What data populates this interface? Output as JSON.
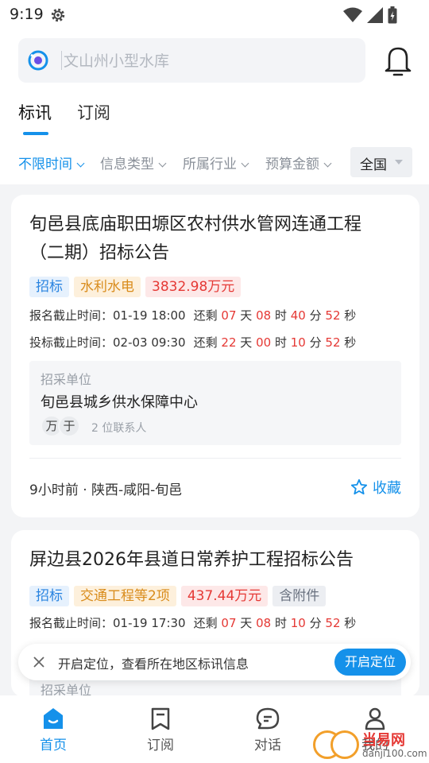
{
  "status_bar": {
    "time": "9:19"
  },
  "search": {
    "placeholder": "文山州小型水库"
  },
  "tabs": [
    {
      "label": "标讯"
    },
    {
      "label": "订阅"
    }
  ],
  "filters": {
    "items": [
      {
        "label": "不限时间"
      },
      {
        "label": "信息类型"
      },
      {
        "label": "所属行业"
      },
      {
        "label": "预算金额"
      }
    ],
    "region": "全国"
  },
  "cards": [
    {
      "title": "旬邑县底庙职田塬区农村供水管网连通工程（二期）招标公告",
      "tags": [
        "招标",
        "水利水电",
        "3832.98万元"
      ],
      "deadline1": {
        "label": "报名截止时间：",
        "datetime": "01-19 18:00",
        "remain": "还剩",
        "d": "07",
        "h": "08",
        "m": "40",
        "s": "52"
      },
      "deadline2": {
        "label": "投标截止时间：",
        "datetime": "02-03 09:30",
        "remain": "还剩",
        "d": "22",
        "h": "00",
        "m": "10",
        "s": "52"
      },
      "units": {
        "day": "天",
        "hour": "时",
        "minute": "分",
        "second": "秒"
      },
      "unit_label": "招采单位",
      "unit_name": "旬邑县城乡供水保障中心",
      "avatars": [
        "万",
        "于"
      ],
      "contacts": "2 位联系人",
      "meta": "9小时前 · 陕西-咸阳-旬邑",
      "favorite": "收藏"
    },
    {
      "title": "屏边县2026年县道日常养护工程招标公告",
      "tags": [
        "招标",
        "交通工程等2项",
        "437.44万元",
        "含附件"
      ],
      "deadline1": {
        "label": "报名截止时间：",
        "datetime": "01-19 17:30",
        "remain": "还剩",
        "d": "07",
        "h": "08",
        "m": "10",
        "s": "52"
      },
      "units": {
        "day": "天",
        "hour": "时",
        "minute": "分",
        "second": "秒"
      },
      "unit_label": "招采单位"
    }
  ],
  "toast": {
    "text": "开启定位，查看所在地区标讯信息",
    "button": "开启定位"
  },
  "bottom_nav": [
    {
      "label": "首页",
      "icon": "home-icon"
    },
    {
      "label": "订阅",
      "icon": "bookmark-icon"
    },
    {
      "label": "对话",
      "icon": "chat-icon"
    },
    {
      "label": "我的",
      "icon": "person-icon"
    }
  ],
  "watermark": {
    "text": "当易网",
    "sub": "danji100.com"
  },
  "colors": {
    "accent": "#1591ea",
    "countdown": "#e53935"
  }
}
